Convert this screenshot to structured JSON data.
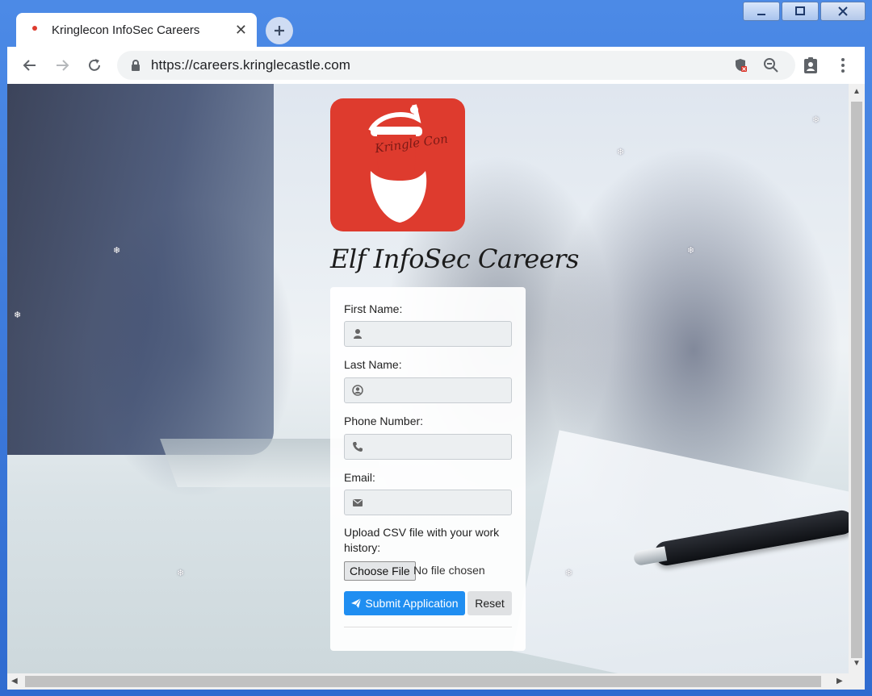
{
  "window": {
    "controls": [
      "minimize",
      "maximize",
      "close"
    ]
  },
  "tab": {
    "title": "Kringlecon InfoSec Careers",
    "close_glyph": "✕"
  },
  "newtab_glyph": "+",
  "address_bar": {
    "url": "https://careers.kringlecastle.com"
  },
  "logo": {
    "text": "Kringle Con"
  },
  "page": {
    "title": "Elf InfoSec Careers"
  },
  "form": {
    "first_name_label": "First Name:",
    "last_name_label": "Last Name:",
    "phone_label": "Phone Number:",
    "email_label": "Email:",
    "upload_label": "Upload CSV file with your work history:",
    "choose_file": "Choose File",
    "file_status": "No file chosen",
    "submit": "Submit Application",
    "reset": "Reset"
  },
  "colors": {
    "accent": "#1f8ef1",
    "logo_bg": "#de3b2e",
    "titlebar": "#3a76d6"
  }
}
